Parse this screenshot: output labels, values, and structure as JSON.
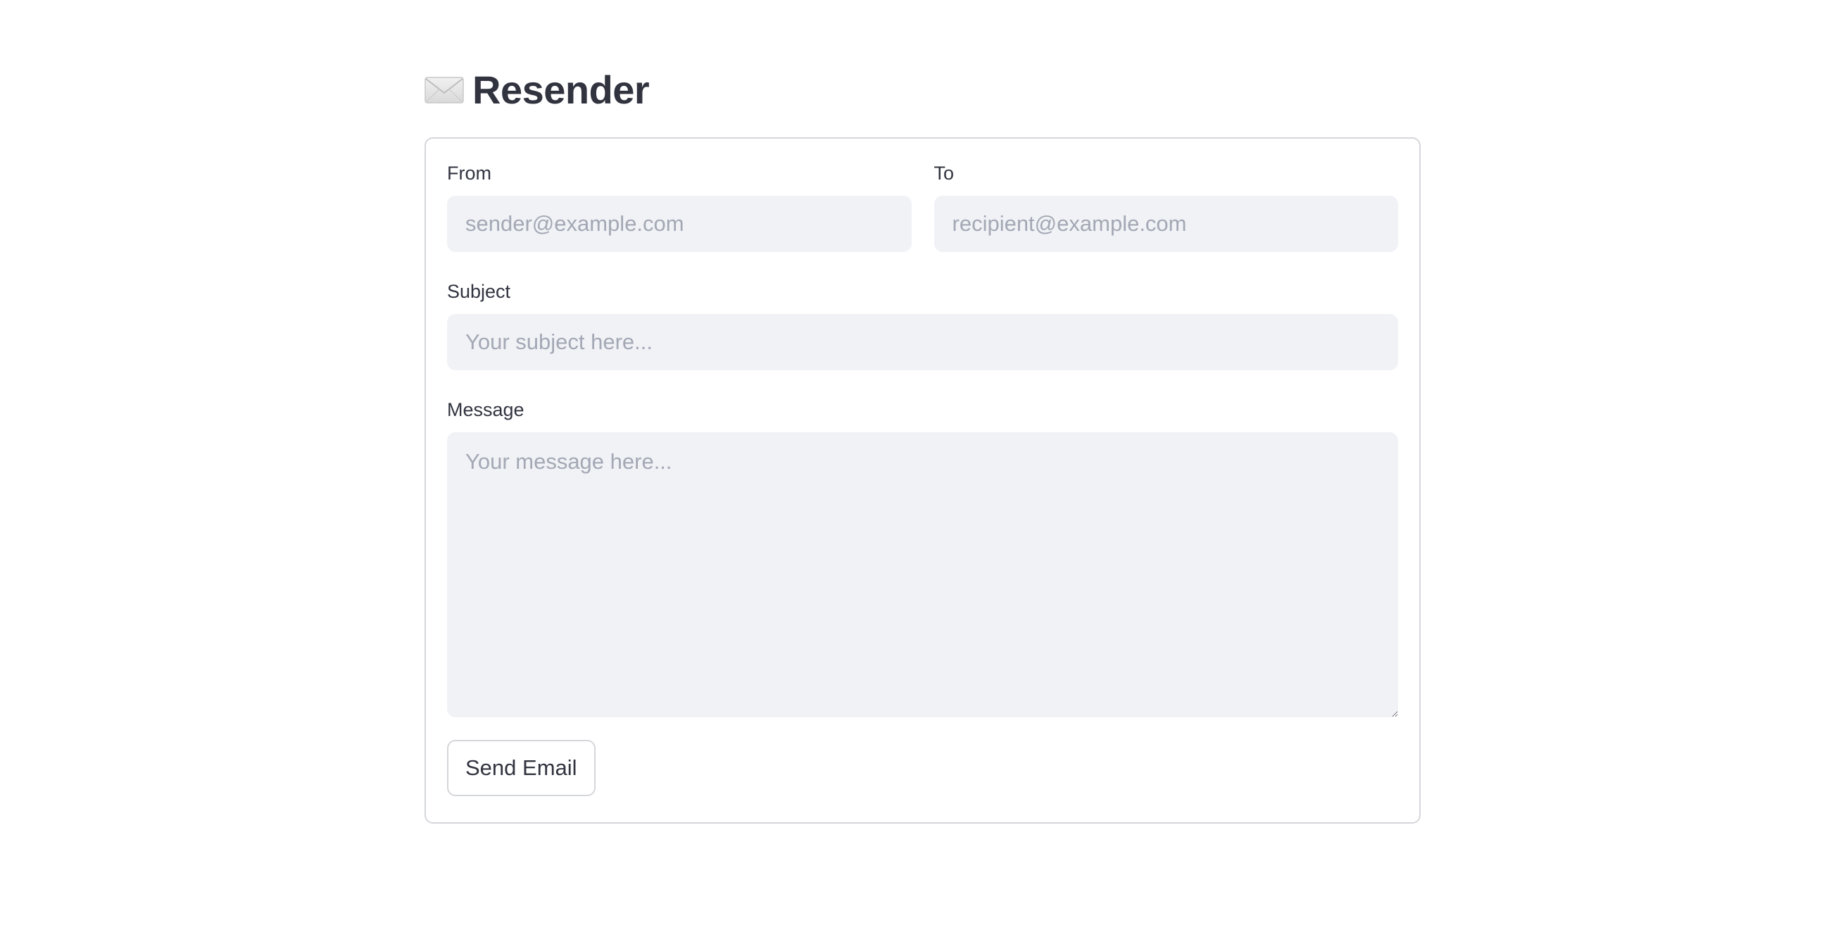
{
  "app": {
    "title": "Resender",
    "title_icon": "envelope-icon"
  },
  "form": {
    "from": {
      "label": "From",
      "value": "",
      "placeholder": "sender@example.com"
    },
    "to": {
      "label": "To",
      "value": "",
      "placeholder": "recipient@example.com"
    },
    "subject": {
      "label": "Subject",
      "value": "",
      "placeholder": "Your subject here..."
    },
    "message": {
      "label": "Message",
      "value": "",
      "placeholder": "Your message here..."
    },
    "send_label": "Send Email"
  },
  "colors": {
    "text": "#31333f",
    "input_bg": "#f0f2f6",
    "placeholder": "#a3a8b4",
    "border": "#d5d6da"
  }
}
